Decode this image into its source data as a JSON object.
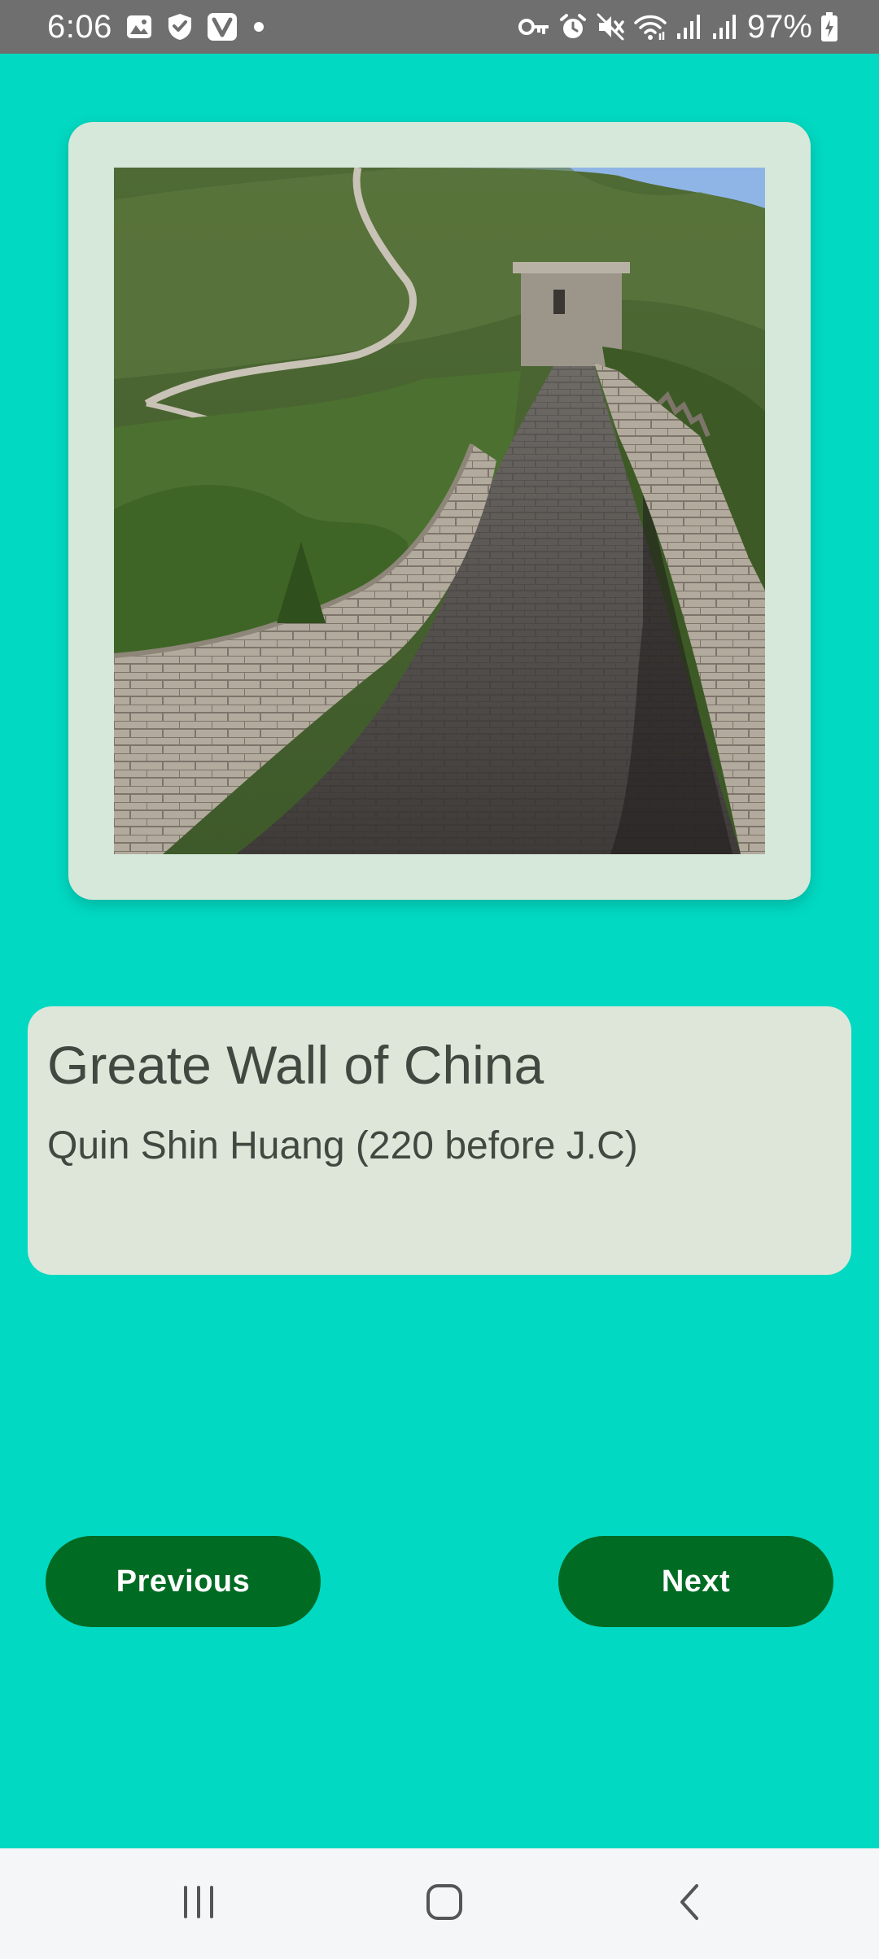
{
  "status_bar": {
    "time": "6:06",
    "battery_percent": "97%",
    "left_icons": [
      "image-notification-icon",
      "shield-check-icon",
      "v-app-icon",
      "dot-icon"
    ],
    "right_icons": [
      "vpn-key-icon",
      "alarm-icon",
      "mute-icon",
      "wifi-icon",
      "signal-icon",
      "signal-icon",
      "battery-charging-icon"
    ]
  },
  "landmark": {
    "image_icon": "great-wall-photo",
    "title": "Greate Wall of China",
    "builder": "Quin Shin Huang (220 before J.C)"
  },
  "buttons": {
    "previous_label": "Previous",
    "next_label": "Next"
  },
  "system_nav": {
    "icons": [
      "recents-icon",
      "home-icon",
      "back-icon"
    ]
  },
  "colors": {
    "background": "#02d9c2",
    "image_card": "#d6e8d9",
    "info_card": "#dee6da",
    "button": "#006b23",
    "button_text": "#ffffff",
    "card_text": "#414840",
    "status_bar": "#6f6f6f",
    "nav_bar": "#f5f6f8"
  }
}
